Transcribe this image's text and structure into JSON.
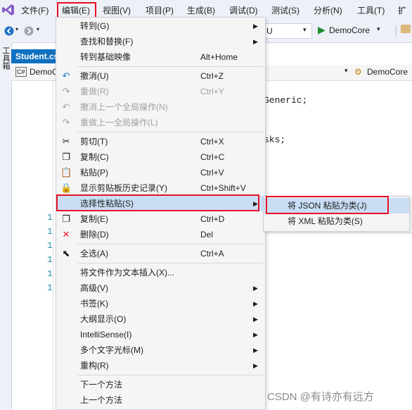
{
  "menubar": {
    "items": [
      "文件(F)",
      "编辑(E)",
      "视图(V)",
      "项目(P)",
      "生成(B)",
      "调试(D)",
      "测试(S)",
      "分析(N)",
      "工具(T)",
      "扩"
    ]
  },
  "toolbar": {
    "config_value": "U",
    "run_label": "DemoCore",
    "run_dropdown": "▾"
  },
  "left_strip": {
    "label": "工具箱"
  },
  "doc_tab": {
    "title": "Student.cs"
  },
  "navbar": {
    "left_prefix": "C#",
    "left_text": "DemoC",
    "right_text": "DemoCore"
  },
  "editor": {
    "code_lines": [
      "Generic;",
      "sks;"
    ],
    "line_numbers": [
      "1",
      "1",
      "1",
      "1",
      "1",
      "1"
    ]
  },
  "edit_menu": {
    "items": [
      {
        "label": "转到(G)",
        "shortcut": "",
        "submenu": true,
        "icon": "",
        "disabled": false
      },
      {
        "label": "查找和替换(F)",
        "shortcut": "",
        "submenu": true,
        "icon": "",
        "disabled": false
      },
      {
        "label": "转到基础映像",
        "shortcut": "Alt+Home",
        "submenu": false,
        "icon": "",
        "disabled": false
      },
      {
        "label": "撤消(U)",
        "shortcut": "Ctrl+Z",
        "submenu": false,
        "icon": "undo-icon",
        "disabled": false
      },
      {
        "label": "重做(R)",
        "shortcut": "Ctrl+Y",
        "submenu": false,
        "icon": "redo-icon",
        "disabled": true
      },
      {
        "label": "撤消上一个全局操作(N)",
        "shortcut": "",
        "submenu": false,
        "icon": "global-undo-icon",
        "disabled": true
      },
      {
        "label": "重做上一全局操作(L)",
        "shortcut": "",
        "submenu": false,
        "icon": "global-redo-icon",
        "disabled": true
      },
      {
        "label": "剪切(T)",
        "shortcut": "Ctrl+X",
        "submenu": false,
        "icon": "cut-icon",
        "disabled": false
      },
      {
        "label": "复制(C)",
        "shortcut": "Ctrl+C",
        "submenu": false,
        "icon": "copy-icon",
        "disabled": false
      },
      {
        "label": "粘贴(P)",
        "shortcut": "Ctrl+V",
        "submenu": false,
        "icon": "paste-icon",
        "disabled": false
      },
      {
        "label": "显示剪贴板历史记录(Y)",
        "shortcut": "Ctrl+Shift+V",
        "submenu": false,
        "icon": "clipboard-history-icon",
        "disabled": false
      },
      {
        "label": "选择性粘贴(S)",
        "shortcut": "",
        "submenu": true,
        "icon": "",
        "disabled": false
      },
      {
        "label": "复制(E)",
        "shortcut": "Ctrl+D",
        "submenu": false,
        "icon": "duplicate-icon",
        "disabled": false
      },
      {
        "label": "删除(D)",
        "shortcut": "Del",
        "submenu": false,
        "icon": "delete-icon",
        "disabled": false
      },
      {
        "label": "全选(A)",
        "shortcut": "Ctrl+A",
        "submenu": false,
        "icon": "select-all-icon",
        "disabled": false
      },
      {
        "label": "将文件作为文本插入(X)...",
        "shortcut": "",
        "submenu": false,
        "icon": "",
        "disabled": false
      },
      {
        "label": "高级(V)",
        "shortcut": "",
        "submenu": true,
        "icon": "",
        "disabled": false
      },
      {
        "label": "书签(K)",
        "shortcut": "",
        "submenu": true,
        "icon": "",
        "disabled": false
      },
      {
        "label": "大纲显示(O)",
        "shortcut": "",
        "submenu": true,
        "icon": "",
        "disabled": false
      },
      {
        "label": "IntelliSense(I)",
        "shortcut": "",
        "submenu": true,
        "icon": "",
        "disabled": false
      },
      {
        "label": "多个文字光标(M)",
        "shortcut": "",
        "submenu": true,
        "icon": "",
        "disabled": false
      },
      {
        "label": "重构(R)",
        "shortcut": "",
        "submenu": true,
        "icon": "",
        "disabled": false
      },
      {
        "label": "下一个方法",
        "shortcut": "",
        "submenu": false,
        "icon": "",
        "disabled": false
      },
      {
        "label": "上一个方法",
        "shortcut": "",
        "submenu": false,
        "icon": "",
        "disabled": false
      }
    ]
  },
  "paste_special_submenu": {
    "items": [
      "将 JSON 粘贴为类(J)",
      "将 XML 粘贴为类(S)"
    ]
  },
  "watermark": "CSDN @有诗亦有远方",
  "colors": {
    "highlight": "#c9def5",
    "red_box": "#e81123",
    "accent": "#0e70c0",
    "run_green": "#1e8a2e"
  }
}
